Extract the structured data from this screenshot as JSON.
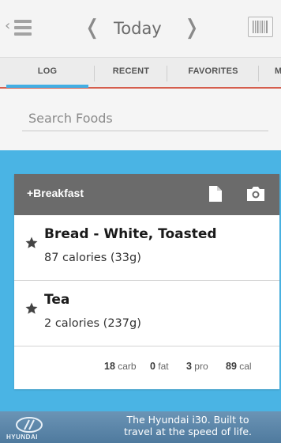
{
  "topbar": {
    "prev_label": "❬",
    "date_label": "Today",
    "next_label": "❭"
  },
  "tabs": [
    {
      "label": "LOG",
      "active": true
    },
    {
      "label": "RECENT",
      "active": false
    },
    {
      "label": "FAVORITES",
      "active": false
    },
    {
      "label": "M",
      "active": false
    }
  ],
  "search": {
    "placeholder": "Search Foods",
    "value": ""
  },
  "meal": {
    "title": "+Breakfast",
    "items": [
      {
        "name": "Bread - White, Toasted",
        "calories": "87 calories (33g)"
      },
      {
        "name": "Tea",
        "calories": "2 calories (237g)"
      }
    ],
    "totals": {
      "carb_value": "18",
      "carb_label": "carb",
      "fat_value": "0",
      "fat_label": "fat",
      "pro_value": "3",
      "pro_label": "pro",
      "cal_value": "89",
      "cal_label": "cal"
    }
  },
  "ad": {
    "brand": "HYUNDAI",
    "line1": "The Hyundai i30. Built to",
    "line2": "travel at the speed of life."
  },
  "colors": {
    "accent_blue": "#4ab4e4",
    "tab_underline": "#d55e4d",
    "meal_header": "#6b6b6b"
  },
  "icons": [
    "menu-icon",
    "barcode-icon",
    "document-icon",
    "camera-icon",
    "star-icon",
    "hyundai-logo"
  ]
}
